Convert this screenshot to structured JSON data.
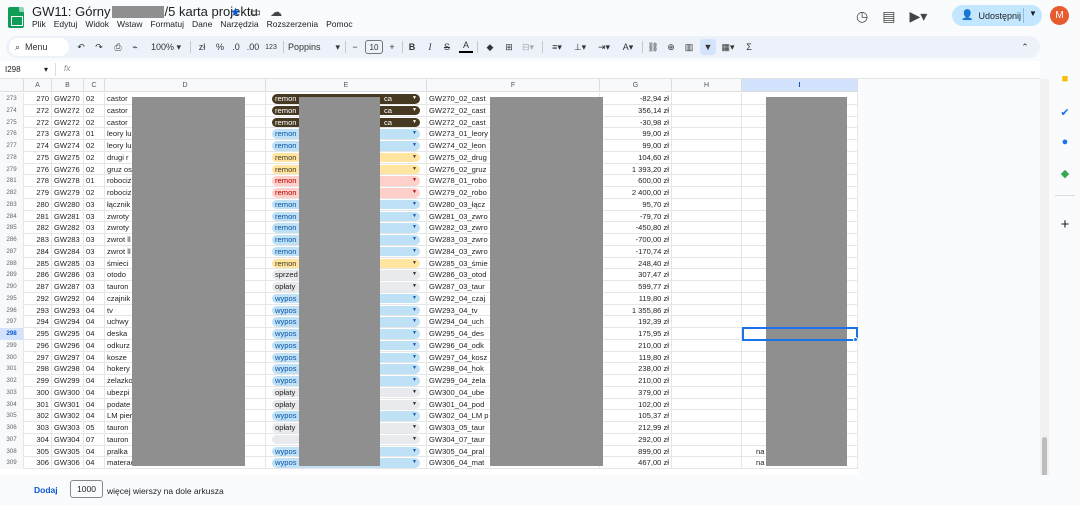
{
  "app": {
    "title_prefix": "GW11: Górny",
    "title_suffix": "/5 karta projektu",
    "menu": [
      "Plik",
      "Edytuj",
      "Widok",
      "Wstaw",
      "Formatuj",
      "Dane",
      "Narzędzia",
      "Rozszerzenia",
      "Pomoc"
    ],
    "share_label": "Udostępnij",
    "avatar_letter": "M"
  },
  "toolbar": {
    "search_label": "Menu",
    "zoom": "100%",
    "currency": "zł",
    "percent": "%",
    "number_format": "123",
    "font": "Poppins",
    "font_size": "10",
    "bold": "B",
    "italic": "I",
    "sum": "Σ"
  },
  "formula_bar": {
    "name_box": "I298",
    "fx": "fx"
  },
  "columns": [
    "A",
    "B",
    "C",
    "D",
    "E",
    "F",
    "G",
    "H",
    "I"
  ],
  "rows": [
    {
      "n": "273",
      "a": "270",
      "b": "GW270",
      "c": "02",
      "d": "castor",
      "e": "remon",
      "e_style": "dark",
      "e_tail": "ca",
      "f": "GW270_02_cast",
      "g": "-82,94 zł"
    },
    {
      "n": "274",
      "a": "272",
      "b": "GW272",
      "c": "02",
      "d": "castor",
      "e": "remon",
      "e_style": "dark",
      "e_tail": "ca",
      "f": "GW272_02_cast",
      "g": "356,14 zł"
    },
    {
      "n": "275",
      "a": "272",
      "b": "GW272",
      "c": "02",
      "d": "castor",
      "e": "remon",
      "e_style": "dark",
      "e_tail": "ca",
      "f": "GW272_02_cast",
      "g": "-30,98 zł"
    },
    {
      "n": "276",
      "a": "273",
      "b": "GW273",
      "c": "01",
      "d": "leory lu",
      "e": "remon",
      "e_style": "blue",
      "e_tail": "",
      "f": "GW273_01_leory",
      "g": "99,00 zł"
    },
    {
      "n": "277",
      "a": "274",
      "b": "GW274",
      "c": "02",
      "d": "leory lu",
      "e": "remon",
      "e_style": "blue",
      "e_tail": "",
      "f": "GW274_02_leon",
      "g": "99,00 zł"
    },
    {
      "n": "278",
      "a": "275",
      "b": "GW275",
      "c": "02",
      "d": "drugi r",
      "e": "remon",
      "e_style": "yellow",
      "e_tail": "",
      "f": "GW275_02_drug",
      "g": "104,60 zł"
    },
    {
      "n": "279",
      "a": "276",
      "b": "GW276",
      "c": "02",
      "d": "gruz os",
      "e": "remon",
      "e_style": "yellow",
      "e_tail": "",
      "f": "GW276_02_gruz",
      "g": "1 393,20 zł"
    },
    {
      "n": "281",
      "a": "278",
      "b": "GW278",
      "c": "01",
      "d": "robociz",
      "e": "remon",
      "e_style": "orange",
      "e_tail": "",
      "f": "GW278_01_robo",
      "g": "600,00 zł"
    },
    {
      "n": "282",
      "a": "279",
      "b": "GW279",
      "c": "02",
      "d": "robociz",
      "e": "remon",
      "e_style": "orange",
      "e_tail": "",
      "f": "GW279_02_robo",
      "g": "2 400,00 zł"
    },
    {
      "n": "283",
      "a": "280",
      "b": "GW280",
      "c": "03",
      "d": "łącznik",
      "e": "remon",
      "e_style": "blue",
      "e_tail": "",
      "f": "GW280_03_łącz",
      "g": "95,70 zł"
    },
    {
      "n": "284",
      "a": "281",
      "b": "GW281",
      "c": "03",
      "d": "zwroty",
      "e": "remon",
      "e_style": "blue",
      "e_tail": "",
      "f": "GW281_03_zwro",
      "g": "-79,70 zł"
    },
    {
      "n": "285",
      "a": "282",
      "b": "GW282",
      "c": "03",
      "d": "zwroty",
      "e": "remon",
      "e_style": "blue",
      "e_tail": "",
      "f": "GW282_03_zwro",
      "g": "-450,80 zł"
    },
    {
      "n": "286",
      "a": "283",
      "b": "GW283",
      "c": "03",
      "d": "zwrot ll",
      "e": "remon",
      "e_style": "blue",
      "e_tail": "",
      "f": "GW283_03_zwro",
      "g": "-700,00 zł"
    },
    {
      "n": "287",
      "a": "284",
      "b": "GW284",
      "c": "03",
      "d": "zwrot ll",
      "e": "remon",
      "e_style": "blue",
      "e_tail": "",
      "f": "GW284_03_zwro",
      "g": "-170,74 zł"
    },
    {
      "n": "288",
      "a": "285",
      "b": "GW285",
      "c": "03",
      "d": "śmieci",
      "e": "remon",
      "e_style": "yellow",
      "e_tail": "",
      "f": "GW285_03_śmie",
      "g": "248,40 zł"
    },
    {
      "n": "289",
      "a": "286",
      "b": "GW286",
      "c": "03",
      "d": "otodo",
      "e": "sprzed",
      "e_style": "gray",
      "e_tail": "",
      "f": "GW286_03_otod",
      "g": "307,47 zł"
    },
    {
      "n": "290",
      "a": "287",
      "b": "GW287",
      "c": "03",
      "d": "tauron",
      "e": "opłaty",
      "e_style": "gray",
      "e_tail": "",
      "f": "GW287_03_taur",
      "g": "599,77 zł"
    },
    {
      "n": "295",
      "a": "292",
      "b": "GW292",
      "c": "04",
      "d": "czajnik",
      "e": "wypos",
      "e_style": "blue",
      "e_tail": "",
      "f": "GW292_04_czaj",
      "g": "119,80 zł"
    },
    {
      "n": "296",
      "a": "293",
      "b": "GW293",
      "c": "04",
      "d": "tv",
      "e": "wypos",
      "e_style": "blue",
      "e_tail": "",
      "f": "GW293_04_tv",
      "g": "1 355,86 zł"
    },
    {
      "n": "297",
      "a": "294",
      "b": "GW294",
      "c": "04",
      "d": "uchwy",
      "e": "wypos",
      "e_style": "blue",
      "e_tail": "",
      "f": "GW294_04_uch",
      "g": "192,39 zł"
    },
    {
      "n": "298",
      "a": "295",
      "b": "GW295",
      "c": "04",
      "d": "deska",
      "e": "wypos",
      "e_style": "blue",
      "e_tail": "",
      "f": "GW295_04_des",
      "g": "175,95 zł"
    },
    {
      "n": "299",
      "a": "296",
      "b": "GW296",
      "c": "04",
      "d": "odkurz",
      "e": "wypos",
      "e_style": "blue",
      "e_tail": "",
      "f": "GW296_04_odk",
      "g": "210,00 zł"
    },
    {
      "n": "300",
      "a": "297",
      "b": "GW297",
      "c": "04",
      "d": "kosze",
      "e": "wypos",
      "e_style": "blue",
      "e_tail": "",
      "f": "GW297_04_kosz",
      "g": "119,80 zł"
    },
    {
      "n": "301",
      "a": "298",
      "b": "GW298",
      "c": "04",
      "d": "hokery",
      "e": "wypos",
      "e_style": "blue",
      "e_tail": "",
      "f": "GW298_04_hok",
      "g": "238,00 zł"
    },
    {
      "n": "302",
      "a": "299",
      "b": "GW299",
      "c": "04",
      "d": "żelazko",
      "e": "wypos",
      "e_style": "blue",
      "e_tail": "",
      "f": "GW299_04_żela",
      "g": "210,00 zł"
    },
    {
      "n": "303",
      "a": "300",
      "b": "GW300",
      "c": "04",
      "d": "ubezpi",
      "e": "opłaty",
      "e_style": "gray",
      "e_tail": "",
      "f": "GW300_04_ube",
      "g": "379,00 zł"
    },
    {
      "n": "304",
      "a": "301",
      "b": "GW301",
      "c": "04",
      "d": "podate",
      "e": "opłaty",
      "e_style": "gray",
      "e_tail": "",
      "f": "GW301_04_pod",
      "g": "102,00 zł"
    },
    {
      "n": "305",
      "a": "302",
      "b": "GW302",
      "c": "04",
      "d": "LM pier",
      "e": "wypos",
      "e_style": "blue",
      "e_tail": "",
      "f": "GW302_04_LM p",
      "g": "105,37 zł"
    },
    {
      "n": "306",
      "a": "303",
      "b": "GW303",
      "c": "05",
      "d": "tauron",
      "e": "opłaty",
      "e_style": "gray",
      "e_tail": "",
      "f": "GW303_05_taur",
      "g": "212,99 zł"
    },
    {
      "n": "307",
      "a": "304",
      "b": "GW304",
      "c": "07",
      "d": "tauron",
      "e": "",
      "e_style": "gray",
      "e_tail": "",
      "f": "GW304_07_taur",
      "g": "292,00 zł"
    },
    {
      "n": "308",
      "a": "305",
      "b": "GW305",
      "c": "04",
      "d": "pralka",
      "e": "wypos",
      "e_style": "blue",
      "e_tail": "",
      "f": "GW305_04_pral",
      "g": "899,00 zł",
      "i": "na"
    },
    {
      "n": "309",
      "a": "306",
      "b": "GW306",
      "c": "04",
      "d": "materac",
      "e": "wypos",
      "e_style": "blue",
      "e_tail": "",
      "f": "GW306_04_mat",
      "g": "467,00 zł",
      "i": "na"
    }
  ],
  "chip_colors": {
    "dark": {
      "bg": "#473822",
      "fg": "#ffffff"
    },
    "blue": {
      "bg": "#bfe1f6",
      "fg": "#0a53a8"
    },
    "yellow": {
      "bg": "#ffe5a0",
      "fg": "#473822"
    },
    "orange": {
      "bg": "#ffcfc9",
      "fg": "#b10202"
    },
    "gray": {
      "bg": "#e8eaed",
      "fg": "#1f1f1f"
    }
  },
  "selected_row": "298",
  "bottom": {
    "add_label": "Dodaj",
    "rows_count": "1000",
    "rows_suffix": "więcej wierszy na dole arkusza"
  }
}
